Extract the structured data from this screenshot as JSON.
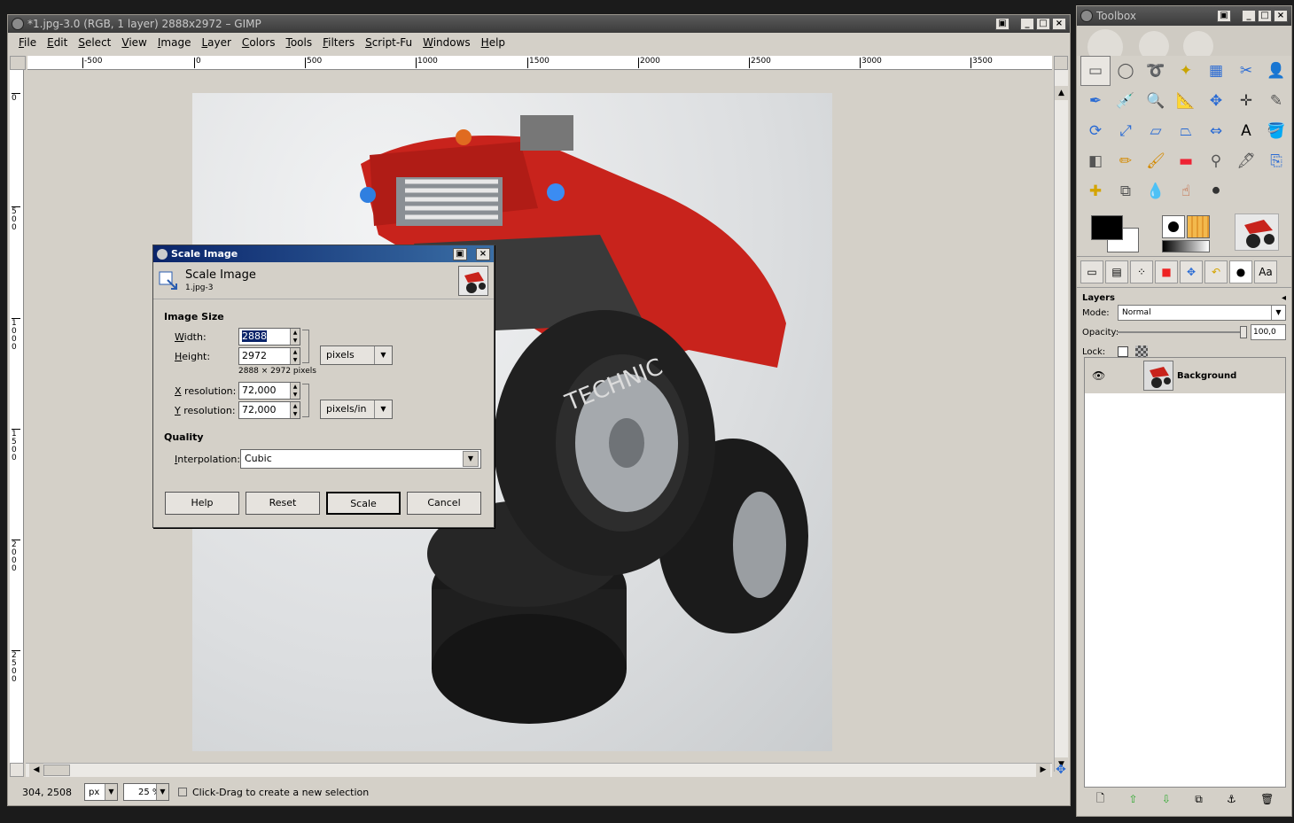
{
  "main_window": {
    "title": "*1.jpg-3.0 (RGB, 1 layer) 2888x2972 – GIMP",
    "menu": [
      "File",
      "Edit",
      "Select",
      "View",
      "Image",
      "Layer",
      "Colors",
      "Tools",
      "Filters",
      "Script-Fu",
      "Windows",
      "Help"
    ],
    "ruler_h_ticks": [
      "-500",
      "0",
      "500",
      "1000",
      "1500",
      "2000",
      "2500",
      "3000",
      "3500"
    ],
    "ruler_v_ticks": [
      "0",
      "500",
      "1000",
      "1500",
      "2000",
      "2500"
    ],
    "status": {
      "coords": "304, 2508",
      "unit": "px",
      "zoom": "25 %",
      "message": "Click-Drag to create a new selection"
    }
  },
  "scale_dialog": {
    "window_title": "Scale Image",
    "header_title": "Scale Image",
    "header_subtitle": "1.jpg-3",
    "image_size_label": "Image Size",
    "width_label": "Width:",
    "width_value": "2888",
    "height_label": "Height:",
    "height_value": "2972",
    "size_unit": "pixels",
    "pixel_note": "2888 × 2972 pixels",
    "xres_label": "X resolution:",
    "xres_value": "72,000",
    "yres_label": "Y resolution:",
    "yres_value": "72,000",
    "res_unit": "pixels/in",
    "quality_label": "Quality",
    "interp_label": "Interpolation:",
    "interp_value": "Cubic",
    "buttons": {
      "help": "Help",
      "reset": "Reset",
      "scale": "Scale",
      "cancel": "Cancel"
    }
  },
  "toolbox": {
    "title": "Toolbox",
    "tools": [
      {
        "name": "rect-select-icon",
        "glyph": "▭"
      },
      {
        "name": "ellipse-select-icon",
        "glyph": "◯"
      },
      {
        "name": "free-select-icon",
        "glyph": "➰"
      },
      {
        "name": "fuzzy-select-icon",
        "glyph": "✦"
      },
      {
        "name": "color-select-icon",
        "glyph": "▦"
      },
      {
        "name": "scissors-select-icon",
        "glyph": "✂"
      },
      {
        "name": "foreground-select-icon",
        "glyph": "👤"
      },
      {
        "name": "paths-icon",
        "glyph": "✒"
      },
      {
        "name": "color-picker-icon",
        "glyph": "💉"
      },
      {
        "name": "zoom-icon",
        "glyph": "🔍"
      },
      {
        "name": "measure-icon",
        "glyph": "📐"
      },
      {
        "name": "move-icon",
        "glyph": "✥"
      },
      {
        "name": "align-icon",
        "glyph": "✛"
      },
      {
        "name": "crop-icon",
        "glyph": "✎"
      },
      {
        "name": "rotate-icon",
        "glyph": "⟳"
      },
      {
        "name": "scale-icon",
        "glyph": "⤢"
      },
      {
        "name": "shear-icon",
        "glyph": "▱"
      },
      {
        "name": "perspective-icon",
        "glyph": "⏢"
      },
      {
        "name": "flip-icon",
        "glyph": "⇔"
      },
      {
        "name": "text-icon",
        "glyph": "A"
      },
      {
        "name": "bucket-fill-icon",
        "glyph": "🪣"
      },
      {
        "name": "blend-icon",
        "glyph": "◧"
      },
      {
        "name": "pencil-icon",
        "glyph": "✏"
      },
      {
        "name": "paintbrush-icon",
        "glyph": "🖌"
      },
      {
        "name": "eraser-icon",
        "glyph": "▬"
      },
      {
        "name": "airbrush-icon",
        "glyph": "⚲"
      },
      {
        "name": "ink-icon",
        "glyph": "🖋"
      },
      {
        "name": "clone-icon",
        "glyph": "⎘"
      },
      {
        "name": "heal-icon",
        "glyph": "✚"
      },
      {
        "name": "perspective-clone-icon",
        "glyph": "⧉"
      },
      {
        "name": "blur-icon",
        "glyph": "💧"
      },
      {
        "name": "smudge-icon",
        "glyph": "☝"
      },
      {
        "name": "dodge-burn-icon",
        "glyph": "⚫"
      }
    ],
    "tabs": [
      "▭",
      "▤",
      "⁘",
      "■",
      "✥",
      "↶",
      "●",
      "Aa"
    ],
    "layers": {
      "header": "Layers",
      "mode_label": "Mode:",
      "mode_value": "Normal",
      "opacity_label": "Opacity:",
      "opacity_value": "100,0",
      "lock_label": "Lock:",
      "layer_name": "Background"
    }
  },
  "colors": {
    "accent": "#0a246a",
    "fg_color": "#000000",
    "bg_color": "#ffffff"
  }
}
